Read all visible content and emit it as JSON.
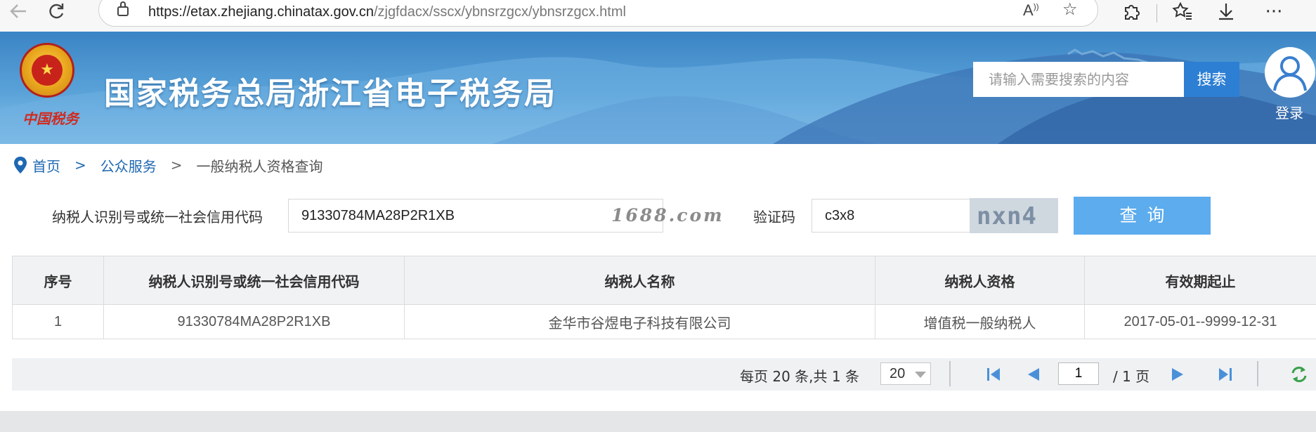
{
  "browser": {
    "url_host": "https://etax.zhejiang.chinatax.gov.cn",
    "url_path": "/zjgfdacx/sscx/ybnsrzgcx/ybnsrzgcx.html"
  },
  "header": {
    "emblem_caption": "中国税务",
    "site_title": "国家税务总局浙江省电子税务局",
    "search_placeholder": "请输入需要搜索的内容",
    "search_button": "搜索",
    "login_label": "登录"
  },
  "breadcrumb": {
    "home": "首页",
    "sep1": ">",
    "section": "公众服务",
    "sep2": ">",
    "current": "一般纳税人资格查询"
  },
  "form": {
    "taxpayer_id_label": "纳税人识别号或统一社会信用代码",
    "taxpayer_id_value": "91330784MA28P2R1XB",
    "watermark": "1688.com",
    "captcha_label": "验证码",
    "captcha_value": "c3x8",
    "captcha_image_text": "nxn4",
    "query_button": "查询"
  },
  "table": {
    "headers": {
      "index": "序号",
      "taxpayer_id": "纳税人识别号或统一社会信用代码",
      "name": "纳税人名称",
      "qualification": "纳税人资格",
      "validity": "有效期起止"
    },
    "rows": [
      {
        "index": "1",
        "taxpayer_id": "91330784MA28P2R1XB",
        "name": "金华市谷煜电子科技有限公司",
        "qualification": "增值税一般纳税人",
        "validity": "2017-05-01--9999-12-31"
      }
    ]
  },
  "pagination": {
    "info": "每页 20 条,共 1 条",
    "page_size": "20",
    "current_page": "1",
    "total_pages": "/ 1 页"
  },
  "colors": {
    "banner": "#4a94d0",
    "search_button": "#2d7fd3",
    "query_button": "#5cacee",
    "link": "#1f68b3",
    "pager_icon": "#4a90d9",
    "refresh_icon": "#3aa04a"
  },
  "icons": {
    "back": "arrow-left-icon",
    "refresh": "refresh-icon",
    "lock": "lock-icon",
    "read_aloud": "read-aloud-icon",
    "favorite": "star-icon",
    "extensions": "puzzle-icon",
    "favorites": "favorites-icon",
    "downloads": "download-icon",
    "more": "more-icon",
    "location": "location-pin-icon",
    "user": "user-icon"
  }
}
